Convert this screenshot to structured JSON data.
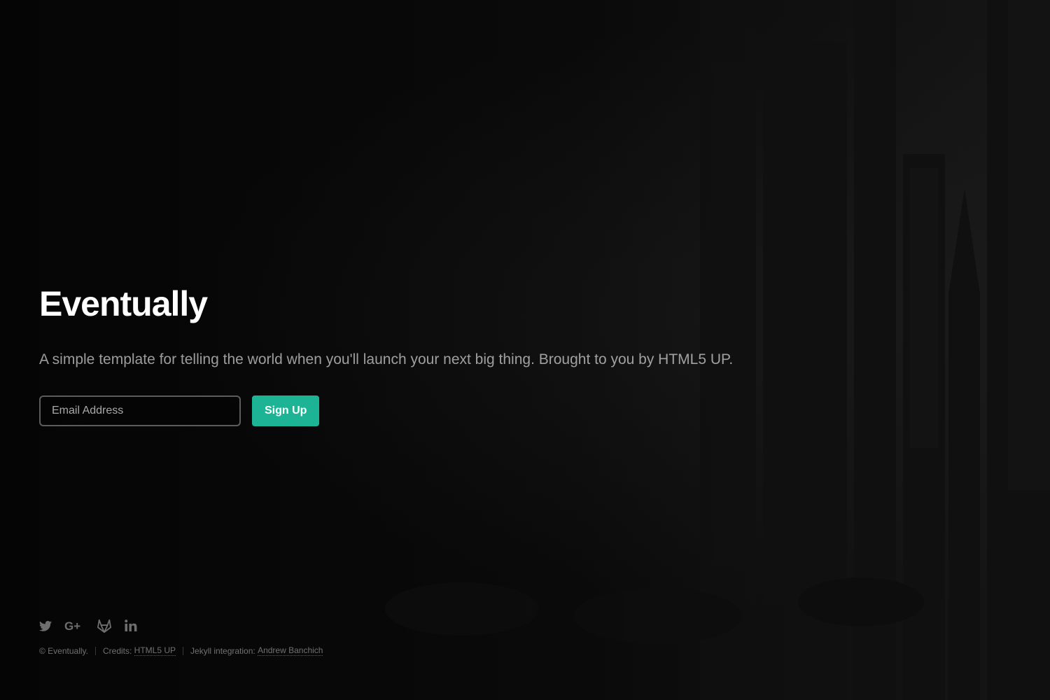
{
  "header": {
    "title": "Eventually",
    "tagline": "A simple template for telling the world when you'll launch your next big thing. Brought to you by HTML5 UP."
  },
  "signup": {
    "email_placeholder": "Email Address",
    "button_label": "Sign Up"
  },
  "social": {
    "icons": [
      "twitter-icon",
      "google-plus-icon",
      "gitlab-icon",
      "linkedin-icon"
    ]
  },
  "footer": {
    "copyright": "© Eventually.",
    "credits_label": "Credits:",
    "credits_link": "HTML5 UP",
    "jekyll_label": "Jekyll integration:",
    "jekyll_link": "Andrew Banchich"
  },
  "colors": {
    "accent": "#1cb495",
    "background": "#060606",
    "title": "#ffffff"
  }
}
